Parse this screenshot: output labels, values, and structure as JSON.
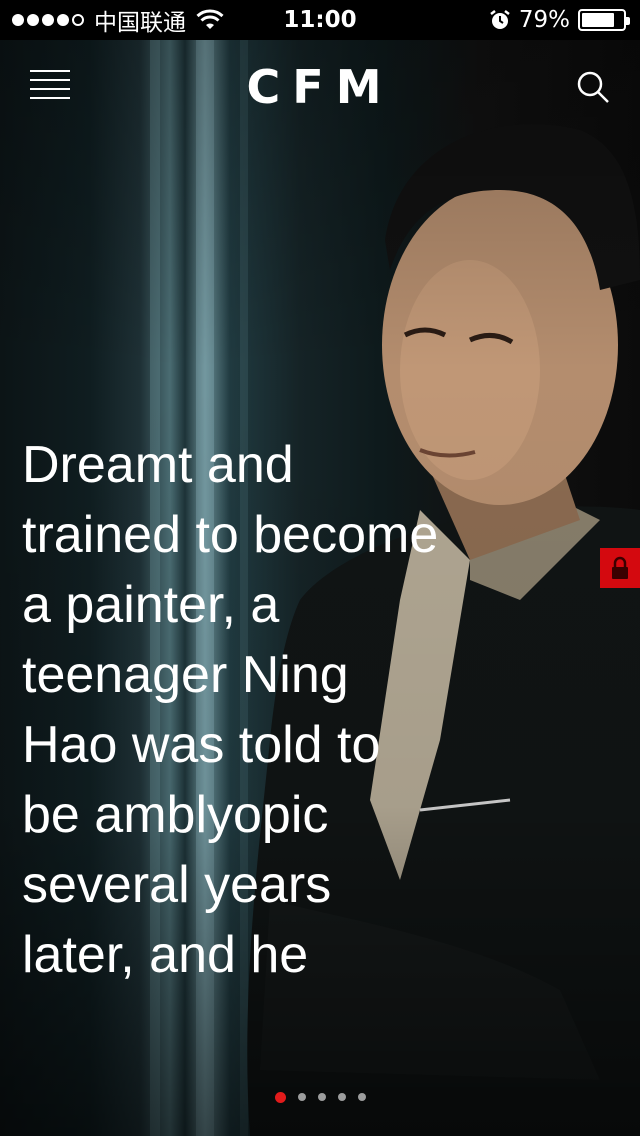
{
  "status_bar": {
    "carrier": "中国联通",
    "time": "11:00",
    "battery_percent_label": "79%",
    "battery_level": 0.79
  },
  "nav": {
    "logo": "CFM",
    "menu_icon": "hamburger-menu-icon",
    "search_icon": "search-icon"
  },
  "lock_icon": "lock-icon",
  "article": {
    "headline": "Dreamt and trained to become a painter, a teenager Ning Hao was told to be amblyopic several years later, and he"
  },
  "pager": {
    "count": 5,
    "active_index": 0
  },
  "colors": {
    "accent": "#d4090f",
    "pager_active": "#e21b1b"
  }
}
